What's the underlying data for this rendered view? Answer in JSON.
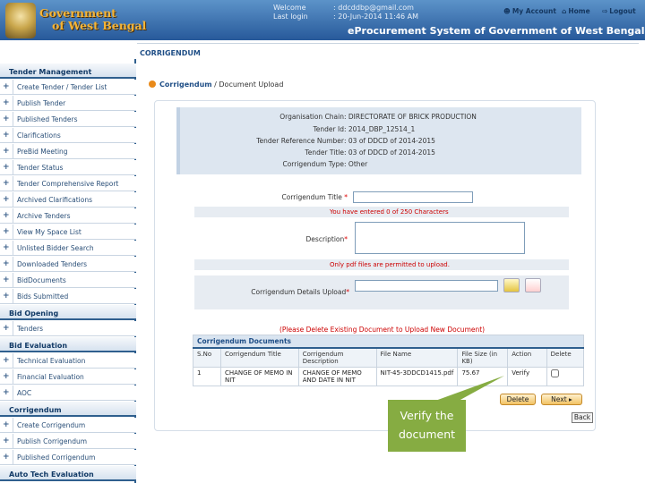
{
  "header": {
    "gov_line1": "Government",
    "gov_line2": "of West Bengal",
    "welcome_label": "Welcome",
    "welcome_value": ": ddcddbp@gmail.com",
    "last_login_label": "Last login",
    "last_login_value": ": 20-Jun-2014 11:46 AM",
    "my_account": "My Account",
    "home": "Home",
    "logout": "Logout",
    "system_title": "eProcurement System of Government of West Bengal"
  },
  "page_title": "CORRIGENDUM",
  "breadcrumb": {
    "part1": "Corrigendum",
    "sep": " / ",
    "part2": "Document Upload"
  },
  "sidebar": {
    "sections": [
      {
        "title": "Tender Management",
        "items": [
          "Create Tender / Tender List",
          "Publish Tender",
          "Published Tenders",
          "Clarifications",
          "PreBid Meeting",
          "Tender Status",
          "Tender Comprehensive Report",
          "Archived Clarifications",
          "Archive Tenders",
          "View My Space List",
          "Unlisted Bidder Search",
          "Downloaded Tenders",
          "BidDocuments",
          "Bids Submitted"
        ]
      },
      {
        "title": "Bid Opening",
        "items": [
          "Tenders"
        ]
      },
      {
        "title": "Bid Evaluation",
        "items": [
          "Technical Evaluation",
          "Financial Evaluation",
          "AOC"
        ]
      },
      {
        "title": "Corrigendum",
        "items": [
          "Create Corrigendum",
          "Publish Corrigendum",
          "Published Corrigendum"
        ]
      },
      {
        "title": "Auto Tech Evaluation",
        "items": []
      }
    ]
  },
  "tender_info": {
    "org_label": "Organisation Chain",
    "org_value": ": DIRECTORATE OF BRICK PRODUCTION",
    "id_label": "Tender Id",
    "id_value": ": 2014_DBP_12514_1",
    "ref_label": "Tender Reference Number",
    "ref_value": ": 03 of DDCD of 2014-2015",
    "title_label": "Tender Title",
    "title_value": ": 03 of DDCD of 2014-2015",
    "type_label": "Corrigendum Type",
    "type_value": ": Other"
  },
  "form": {
    "title_label": "Corrigendum Title",
    "title_value": "",
    "char_note": "You have entered 0 of 250 Characters",
    "desc_label": "Description",
    "desc_value": "",
    "pdf_note": "Only pdf files are permitted to upload.",
    "upload_label": "Corrigendum Details Upload",
    "upload_value": "",
    "delete_note": "(Please Delete Existing Document to Upload New Document)"
  },
  "documents": {
    "caption": "Corrigendum Documents",
    "headers": [
      "S.No",
      "Corrigendum Title",
      "Corrigendum Description",
      "File Name",
      "File Size (in KB)",
      "Action",
      "Delete"
    ],
    "rows": [
      [
        "1",
        "CHANGE OF MEMO IN NIT",
        "CHANGE OF MEMO AND DATE IN NIT",
        "NIT-45-3DDCD1415.pdf",
        "75.67",
        "Verify"
      ]
    ]
  },
  "buttons": {
    "delete": "Delete",
    "next": "Next",
    "back": "Back"
  },
  "callout": {
    "line1": "Verify the",
    "line2": "document"
  },
  "colors": {
    "header_top": "#5c93c9",
    "header_bottom": "#27599a",
    "accent_orange": "#e98a1a",
    "callout_green": "#86ac42"
  }
}
